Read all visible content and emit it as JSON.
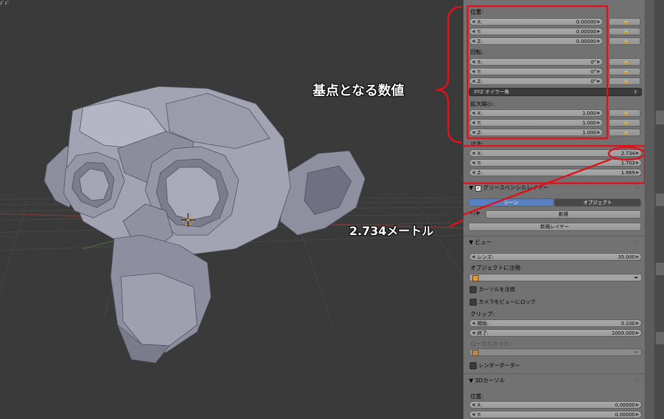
{
  "viewport": {
    "corner_text": "ﾃﾞﾃﾞ"
  },
  "panel": {
    "location": {
      "label": "位置:",
      "fields": [
        {
          "axis": "X:",
          "value": "0.00000"
        },
        {
          "axis": "Y:",
          "value": "0.00000"
        },
        {
          "axis": "Z:",
          "value": "0.00000"
        }
      ]
    },
    "rotation": {
      "label": "回転:",
      "fields": [
        {
          "axis": "X:",
          "value": "0°"
        },
        {
          "axis": "Y:",
          "value": "0°"
        },
        {
          "axis": "Z:",
          "value": "0°"
        }
      ],
      "mode": "XYZ オイラー角"
    },
    "scale": {
      "label": "拡大縮小:",
      "fields": [
        {
          "axis": "X:",
          "value": "1.000"
        },
        {
          "axis": "Y:",
          "value": "1.000"
        },
        {
          "axis": "Z:",
          "value": "1.000"
        }
      ]
    },
    "dimensions": {
      "label": "寸法:",
      "fields": [
        {
          "axis": "X:",
          "value": "2.734"
        },
        {
          "axis": "Y:",
          "value": "1.703"
        },
        {
          "axis": "Z:",
          "value": "1.969"
        }
      ]
    },
    "grease_pencil": {
      "title": "グリースペンシルレイヤー",
      "tab_scene": "シーン",
      "tab_object": "オブジェクト",
      "new_label": "新規",
      "new_layer_label": "新規レイヤー"
    },
    "view": {
      "title": "ビュー",
      "lens_label": "レンズ:",
      "lens_value": "35.000",
      "lock_object_label": "オブジェクトに注視:",
      "lock_cursor_label": "カーソルを注視",
      "lock_camera_label": "カメラをビューにロック",
      "clip_label": "クリップ:",
      "clip_start_label": "開始:",
      "clip_start_value": "0.100",
      "clip_end_label": "終了:",
      "clip_end_value": "1000.000",
      "local_camera_label": "ローカルカメラ:",
      "render_border_label": "レンダーボーダー"
    },
    "cursor": {
      "title": "3Dカーソル",
      "location_label": "位置:",
      "fields": [
        {
          "axis": "X:",
          "value": "0.00000"
        },
        {
          "axis": "Y:",
          "value": "0.00000"
        }
      ]
    }
  },
  "annotations": {
    "base_values": "基点となる数値",
    "meters": "2.734メートル"
  },
  "colors": {
    "annotation_red": "#e0111b",
    "tab_active": "#5680c2"
  }
}
